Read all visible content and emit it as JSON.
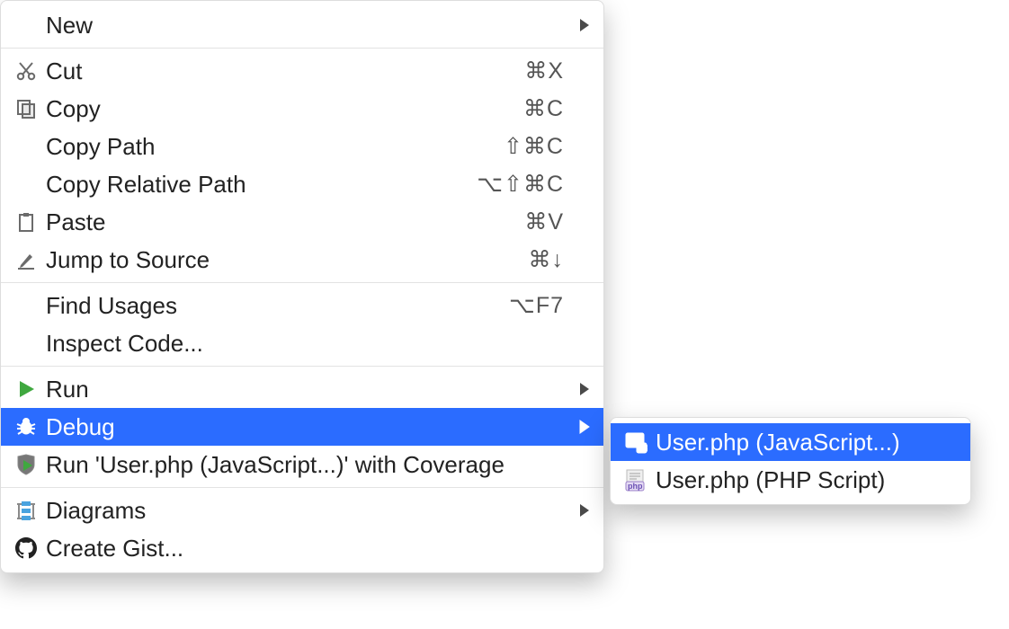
{
  "mainMenu": {
    "new": "New",
    "cut": {
      "label": "Cut",
      "shortcut": "⌘X"
    },
    "copy": {
      "label": "Copy",
      "shortcut": "⌘C"
    },
    "copyPath": {
      "label": "Copy Path",
      "shortcut": "⇧⌘C"
    },
    "copyRelativePath": {
      "label": "Copy Relative Path",
      "shortcut": "⌥⇧⌘C"
    },
    "paste": {
      "label": "Paste",
      "shortcut": "⌘V"
    },
    "jumpToSource": {
      "label": "Jump to Source",
      "shortcut": "⌘↓"
    },
    "findUsages": {
      "label": "Find Usages",
      "shortcut": "⌥F7"
    },
    "inspectCode": "Inspect Code...",
    "run": "Run",
    "debug": "Debug",
    "runWithCoverage": "Run 'User.php (JavaScript...)' with Coverage",
    "diagrams": "Diagrams",
    "createGist": "Create Gist..."
  },
  "subMenu": {
    "userJs": "User.php (JavaScript...)",
    "userPhp": "User.php (PHP Script)"
  }
}
